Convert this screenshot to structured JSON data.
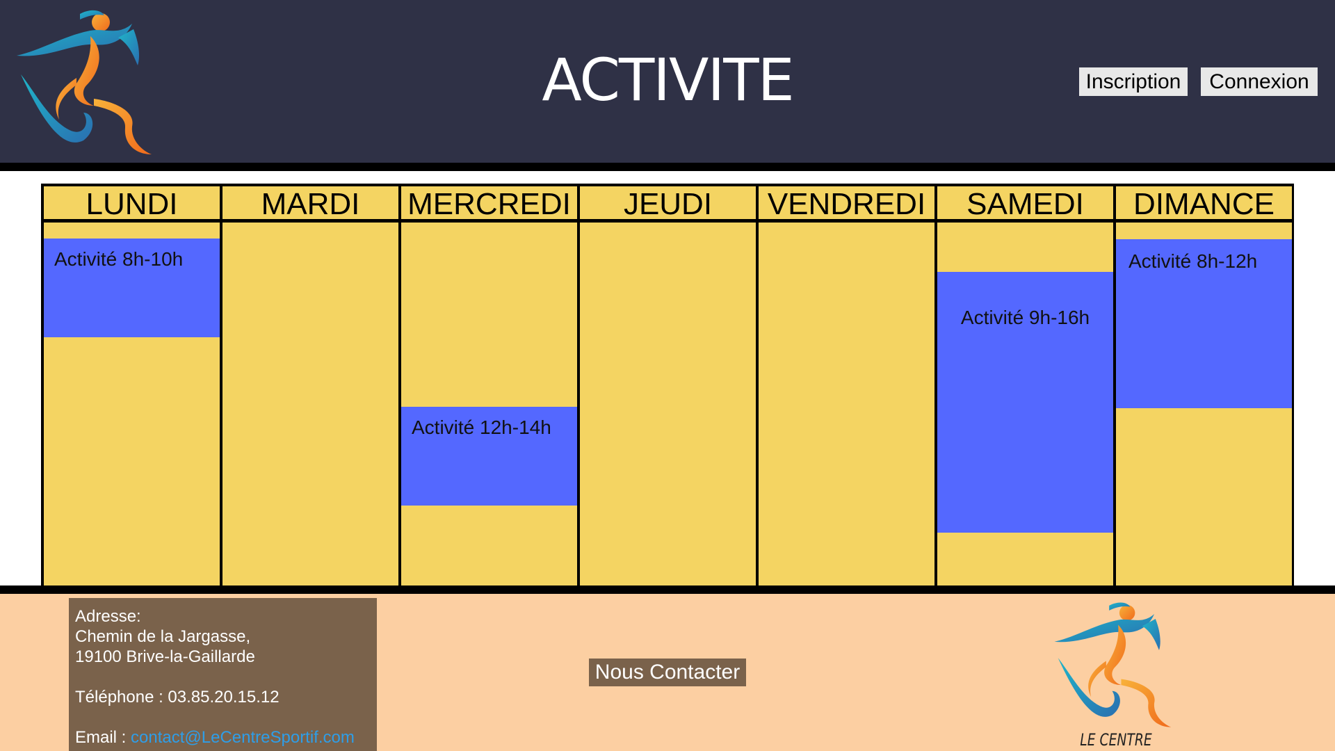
{
  "header": {
    "title": "ACTIVITE",
    "buttons": {
      "inscription": "Inscription",
      "connexion": "Connexion"
    },
    "logo_icon": "runner-logo-icon"
  },
  "schedule": {
    "days": [
      {
        "label": "LUNDI",
        "activity": "Activité 8h-10h"
      },
      {
        "label": "MARDI",
        "activity": null
      },
      {
        "label": "MERCREDI",
        "activity": "Activité 12h-14h"
      },
      {
        "label": "JEUDI",
        "activity": null
      },
      {
        "label": "VENDREDI",
        "activity": null
      },
      {
        "label": "SAMEDI",
        "activity": "Activité 9h-16h"
      },
      {
        "label": "DIMANCE",
        "activity": "Activité 8h-12h"
      }
    ]
  },
  "footer": {
    "address_label": "Adresse:",
    "address_line1": "Chemin de la Jargasse,",
    "address_line2": "19100 Brive-la-Gaillarde",
    "phone": "Téléphone : 03.85.20.15.12",
    "email_label": "Email : ",
    "email": "contact@LeCentreSportif.com",
    "contact_button": "Nous Contacter",
    "brand": "LE CENTRE SPORTIF"
  },
  "colors": {
    "header_bg": "#2f3146",
    "cell_bg": "#f4d462",
    "activity_bg": "#5468ff",
    "footer_bg": "#fccfa2",
    "contact_box_bg": "#7a624b"
  }
}
